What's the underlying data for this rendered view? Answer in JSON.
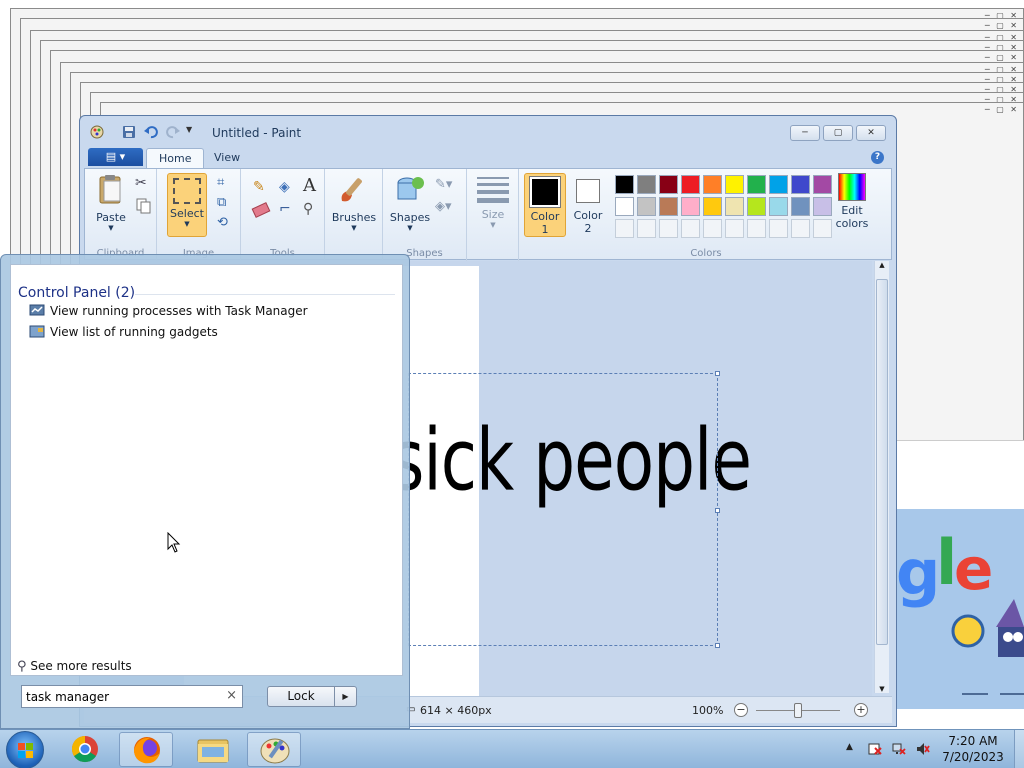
{
  "paint": {
    "title": "Untitled - Paint",
    "tabs": [
      "Home",
      "View"
    ],
    "buttons": {
      "paste": "Paste",
      "select": "Select",
      "brushes": "Brushes",
      "shapes": "Shapes",
      "size": "Size",
      "color1": "Color",
      "color1_num": "1",
      "color2": "Color",
      "color2_num": "2",
      "edit_colors_1": "Edit",
      "edit_colors_2": "colors"
    },
    "groups": [
      "Clipboard",
      "Image",
      "Tools",
      "Shapes",
      "Colors"
    ],
    "palette": [
      "#000000",
      "#7f7f7f",
      "#880015",
      "#ed1c24",
      "#ff7f27",
      "#fff200",
      "#22b14c",
      "#00a2e8",
      "#3f48cc",
      "#a349a4",
      "#ffffff",
      "#c3c3c3",
      "#b97a57",
      "#ffaec9",
      "#ffc90e",
      "#efe4b0",
      "#b5e61d",
      "#99d9ea",
      "#7092be",
      "#c8bfe7"
    ],
    "canvas_text": "y sick people",
    "status": {
      "dimensions": "614 × 460px",
      "zoom": "100%"
    }
  },
  "start_menu": {
    "heading": "Control Panel (2)",
    "results": [
      "View running processes with Task Manager",
      "View list of running gadgets"
    ],
    "see_more": "See more results",
    "search_value": "task manager",
    "lock_label": "Lock"
  },
  "taskbar": {
    "time": "7:20 AM",
    "date": "7/20/2023",
    "pinned": [
      "chrome-icon",
      "firefox-icon",
      "explorer-icon",
      "paint-icon"
    ]
  }
}
